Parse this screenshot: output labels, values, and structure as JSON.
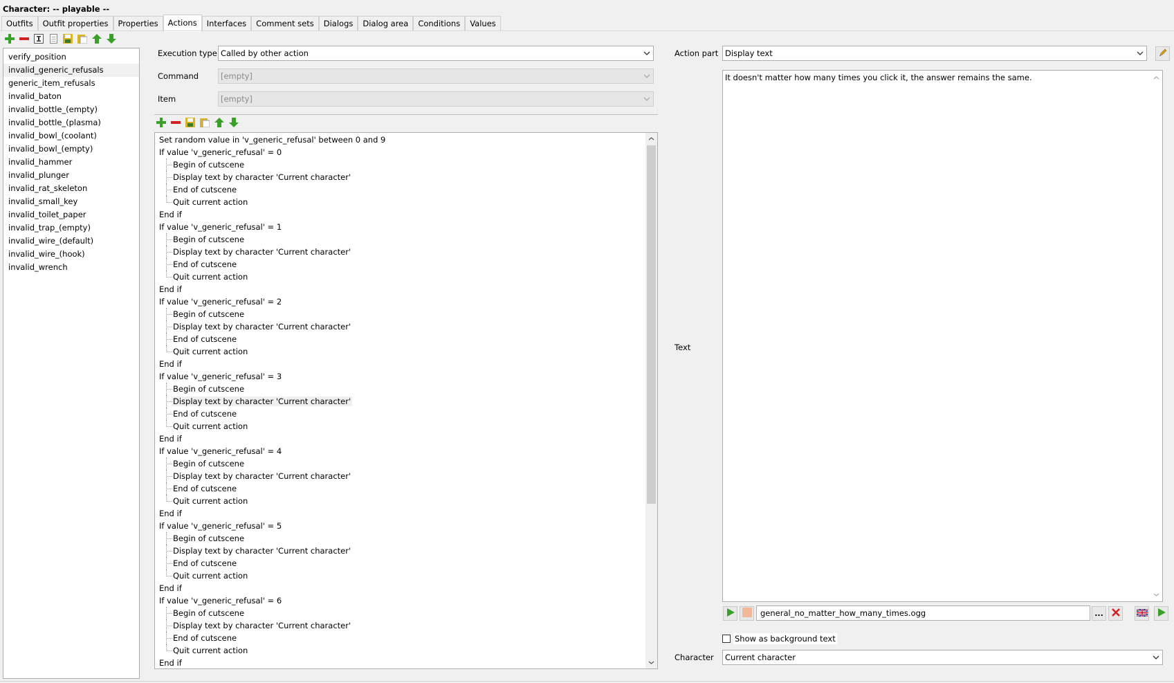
{
  "window": {
    "title": "Character: -- playable  --"
  },
  "tabs": [
    "Outfits",
    "Outfit properties",
    "Properties",
    "Actions",
    "Interfaces",
    "Comment sets",
    "Dialogs",
    "Dialog area",
    "Conditions",
    "Values"
  ],
  "active_tab": "Actions",
  "actions_list": [
    "verify_position",
    "invalid_generic_refusals",
    "generic_item_refusals",
    "invalid_baton",
    "invalid_bottle_(empty)",
    "invalid_bottle_(plasma)",
    "invalid_bowl_(coolant)",
    "invalid_bowl_(empty)",
    "invalid_hammer",
    "invalid_plunger",
    "invalid_rat_skeleton",
    "invalid_small_key",
    "invalid_toilet_paper",
    "invalid_trap_(empty)",
    "invalid_wire_(default)",
    "invalid_wire_(hook)",
    "invalid_wrench"
  ],
  "selected_action": "invalid_generic_refusals",
  "form": {
    "execution_type_label": "Execution type",
    "execution_type_value": "Called by other action",
    "command_label": "Command",
    "command_value": "[empty]",
    "item_label": "Item",
    "item_value": "[empty]"
  },
  "script_lines": [
    {
      "level": 0,
      "text": "Set random value in 'v_generic_refusal' between 0 and 9"
    },
    {
      "level": 0,
      "text": "If value 'v_generic_refusal' = 0"
    },
    {
      "level": 1,
      "text": "Begin of cutscene"
    },
    {
      "level": 1,
      "text": "Display text by character 'Current character'"
    },
    {
      "level": 1,
      "text": "End of cutscene"
    },
    {
      "level": 1,
      "text": "Quit current action",
      "last": true
    },
    {
      "level": 0,
      "text": "End if"
    },
    {
      "level": 0,
      "text": "If value 'v_generic_refusal' = 1"
    },
    {
      "level": 1,
      "text": "Begin of cutscene"
    },
    {
      "level": 1,
      "text": "Display text by character 'Current character'"
    },
    {
      "level": 1,
      "text": "End of cutscene"
    },
    {
      "level": 1,
      "text": "Quit current action",
      "last": true
    },
    {
      "level": 0,
      "text": "End if"
    },
    {
      "level": 0,
      "text": "If value 'v_generic_refusal' = 2"
    },
    {
      "level": 1,
      "text": "Begin of cutscene"
    },
    {
      "level": 1,
      "text": "Display text by character 'Current character'"
    },
    {
      "level": 1,
      "text": "End of cutscene"
    },
    {
      "level": 1,
      "text": "Quit current action",
      "last": true
    },
    {
      "level": 0,
      "text": "End if"
    },
    {
      "level": 0,
      "text": "If value 'v_generic_refusal' = 3"
    },
    {
      "level": 1,
      "text": "Begin of cutscene"
    },
    {
      "level": 1,
      "text": "Display text by character 'Current character'",
      "selected": true
    },
    {
      "level": 1,
      "text": "End of cutscene"
    },
    {
      "level": 1,
      "text": "Quit current action",
      "last": true
    },
    {
      "level": 0,
      "text": "End if"
    },
    {
      "level": 0,
      "text": "If value 'v_generic_refusal' = 4"
    },
    {
      "level": 1,
      "text": "Begin of cutscene"
    },
    {
      "level": 1,
      "text": "Display text by character 'Current character'"
    },
    {
      "level": 1,
      "text": "End of cutscene"
    },
    {
      "level": 1,
      "text": "Quit current action",
      "last": true
    },
    {
      "level": 0,
      "text": "End if"
    },
    {
      "level": 0,
      "text": "If value 'v_generic_refusal' = 5"
    },
    {
      "level": 1,
      "text": "Begin of cutscene"
    },
    {
      "level": 1,
      "text": "Display text by character 'Current character'"
    },
    {
      "level": 1,
      "text": "End of cutscene"
    },
    {
      "level": 1,
      "text": "Quit current action",
      "last": true
    },
    {
      "level": 0,
      "text": "End if"
    },
    {
      "level": 0,
      "text": "If value 'v_generic_refusal' = 6"
    },
    {
      "level": 1,
      "text": "Begin of cutscene"
    },
    {
      "level": 1,
      "text": "Display text by character 'Current character'"
    },
    {
      "level": 1,
      "text": "End of cutscene"
    },
    {
      "level": 1,
      "text": "Quit current action",
      "last": true
    },
    {
      "level": 0,
      "text": "End if"
    }
  ],
  "right": {
    "action_part_label": "Action part",
    "action_part_value": "Display text",
    "text_label": "Text",
    "text_value": "It doesn't matter how many times you click it, the answer remains the same.",
    "audio_file": "general_no_matter_how_many_times.ogg",
    "more_label": "...",
    "show_bg_label": "Show as background text",
    "character_label": "Character",
    "character_value": "Current character"
  },
  "icons": {
    "add": "plus-icon",
    "remove": "minus-icon",
    "rename": "rename-icon",
    "copy": "copy-icon",
    "save": "save-icon",
    "paste": "paste-icon",
    "up": "arrow-up-icon",
    "down": "arrow-down-icon",
    "edit": "pencil-icon",
    "play": "play-icon",
    "record": "record-icon",
    "delete": "delete-icon",
    "flag": "flag-uk-icon",
    "dropdown": "chevron-down-icon"
  },
  "colors": {
    "green": "#3aa02a",
    "red": "#d02020",
    "yellow": "#d8b42a",
    "orange_box": "#f3b79a"
  }
}
